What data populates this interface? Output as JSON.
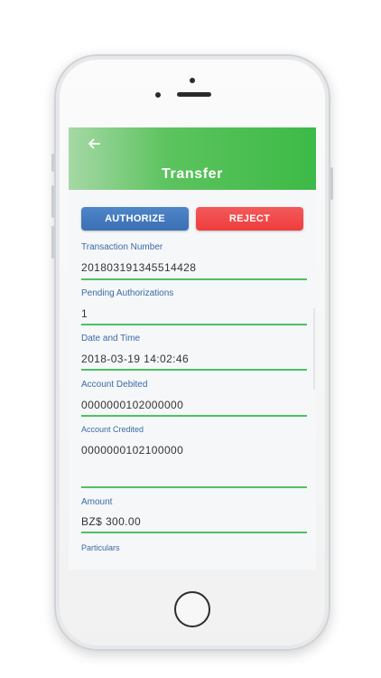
{
  "header": {
    "title": "Transfer",
    "back_icon": "arrow-left-icon"
  },
  "actions": {
    "authorize_label": "AUTHORIZE",
    "reject_label": "REJECT"
  },
  "fields": [
    {
      "label": "Transaction Number",
      "value": "201803191345514428"
    },
    {
      "label": "Pending Authorizations",
      "value": "1"
    },
    {
      "label": "Date and Time",
      "value": "2018-03-19 14:02:46"
    },
    {
      "label": "Account Debited",
      "value": "0000000102000000"
    },
    {
      "label": "Account Credited",
      "value": "0000000102100000"
    },
    {
      "label": "Amount",
      "value": "BZ$ 300.00"
    },
    {
      "label": "Particulars",
      "value": ""
    }
  ],
  "colors": {
    "header_green": "#3dba47",
    "authorize_blue": "#3b6fb3",
    "reject_red": "#ef3c3c",
    "label_blue": "#3a6aa6",
    "underline_green": "#4cc265"
  }
}
